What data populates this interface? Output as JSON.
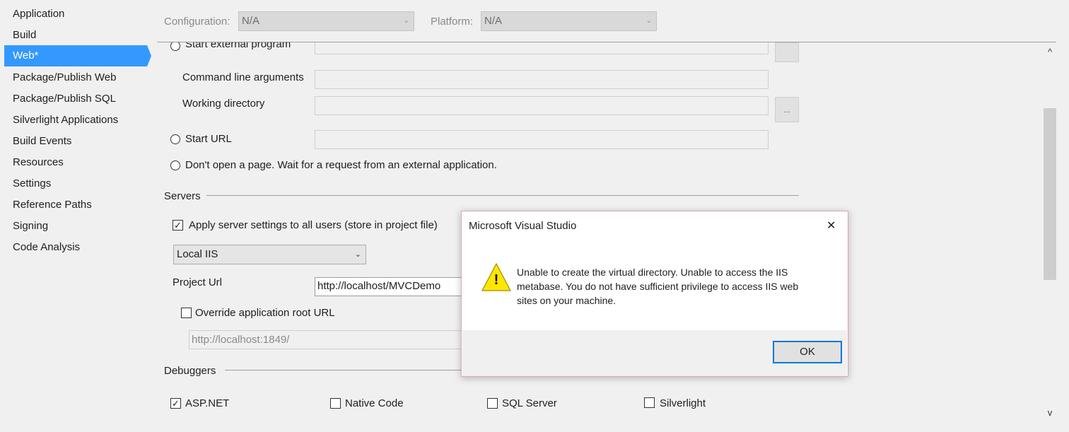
{
  "sidebar": {
    "items": [
      {
        "label": "Application"
      },
      {
        "label": "Build"
      },
      {
        "label": "Web*"
      },
      {
        "label": "Package/Publish Web"
      },
      {
        "label": "Package/Publish SQL"
      },
      {
        "label": "Silverlight Applications"
      },
      {
        "label": "Build Events"
      },
      {
        "label": "Resources"
      },
      {
        "label": "Settings"
      },
      {
        "label": "Reference Paths"
      },
      {
        "label": "Signing"
      },
      {
        "label": "Code Analysis"
      }
    ],
    "active_index": 2
  },
  "config_bar": {
    "configuration_label": "Configuration:",
    "configuration_value": "N/A",
    "platform_label": "Platform:",
    "platform_value": "N/A"
  },
  "start_action": {
    "start_external_program_label": "Start external program",
    "command_line_arguments_label": "Command line arguments",
    "command_line_arguments_value": "",
    "working_directory_label": "Working directory",
    "working_directory_value": "",
    "browse_label": "...",
    "start_url_label": "Start URL",
    "start_url_value": "",
    "dont_open_page_label": "Don't open a page.  Wait for a request from an external application."
  },
  "servers": {
    "section_label": "Servers",
    "apply_all_users_label": "Apply server settings to all users (store in project file)",
    "apply_all_users_checked": true,
    "server_type": "Local IIS",
    "project_url_label": "Project Url",
    "project_url_value": "http://localhost/MVCDemo",
    "override_root_label": "Override application root URL",
    "override_root_checked": false,
    "override_root_value": "http://localhost:1849/"
  },
  "debuggers": {
    "section_label": "Debuggers",
    "items": [
      {
        "label": "ASP.NET",
        "checked": true
      },
      {
        "label": "Native Code",
        "checked": false
      },
      {
        "label": "SQL Server",
        "checked": false
      },
      {
        "label": "Silverlight",
        "checked": false
      }
    ]
  },
  "dialog": {
    "title": "Microsoft Visual Studio",
    "close_glyph": "✕",
    "warning_glyph": "!",
    "message_line1": "Unable to create the virtual directory. Unable to access the IIS",
    "message_line2": "metabase. You do not have sufficient privilege to access IIS web",
    "message_line3": "sites on your machine.",
    "ok_label": "OK"
  },
  "colors": {
    "accent": "#3399ff",
    "ok_border": "#0078d7",
    "warning_fill": "#ffe600"
  },
  "icons": {
    "checkmark": "✓",
    "chevron_down": "⌄",
    "scroll_up": "^",
    "scroll_down": "v"
  }
}
